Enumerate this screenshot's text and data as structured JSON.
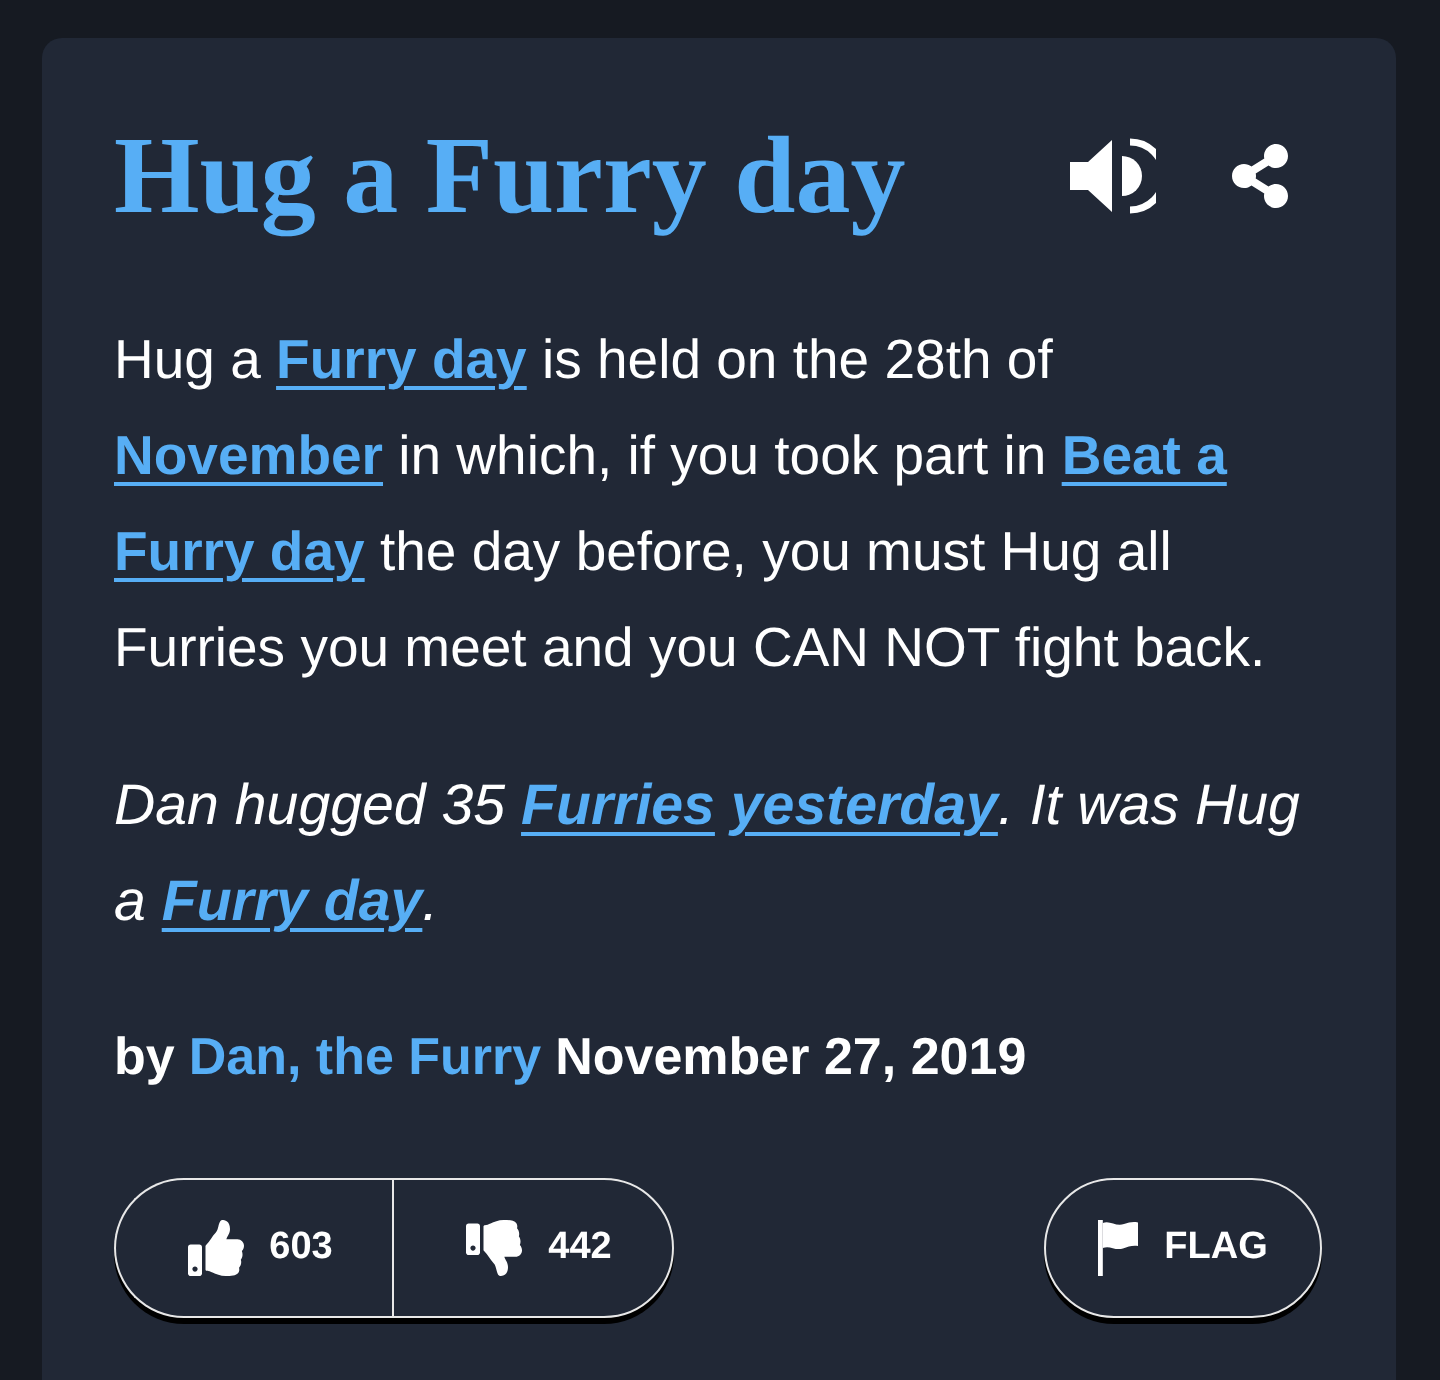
{
  "entry": {
    "title": "Hug a Furry day"
  },
  "definition": [
    {
      "kind": "text",
      "text": "Hug a "
    },
    {
      "kind": "link",
      "text": "Furry day"
    },
    {
      "kind": "text",
      "text": " is held on the 28th of "
    },
    {
      "kind": "link",
      "text": "November"
    },
    {
      "kind": "text",
      "text": " in which, if you took part in "
    },
    {
      "kind": "link",
      "text": "Beat a"
    },
    {
      "kind": "link",
      "text": "Furry day"
    },
    {
      "kind": "text",
      "text": " the day before, you must Hug all Furries you meet and you CAN NOT fight back."
    }
  ],
  "example": [
    {
      "kind": "text",
      "text": "Dan hugged 35 "
    },
    {
      "kind": "link",
      "text": "Furries"
    },
    {
      "kind": "link",
      "text": "yesterday"
    },
    {
      "kind": "text",
      "text": ". It was Hug a "
    },
    {
      "kind": "link",
      "text": "Furry day"
    },
    {
      "kind": "text",
      "text": "."
    }
  ],
  "byline": {
    "prefix": "by",
    "author": "Dan, the Furry",
    "date": "November 27, 2019"
  },
  "votes": [
    {
      "kind": "up",
      "count": "603"
    },
    {
      "kind": "down",
      "count": "442"
    }
  ],
  "flag": {
    "label": "FLAG"
  }
}
